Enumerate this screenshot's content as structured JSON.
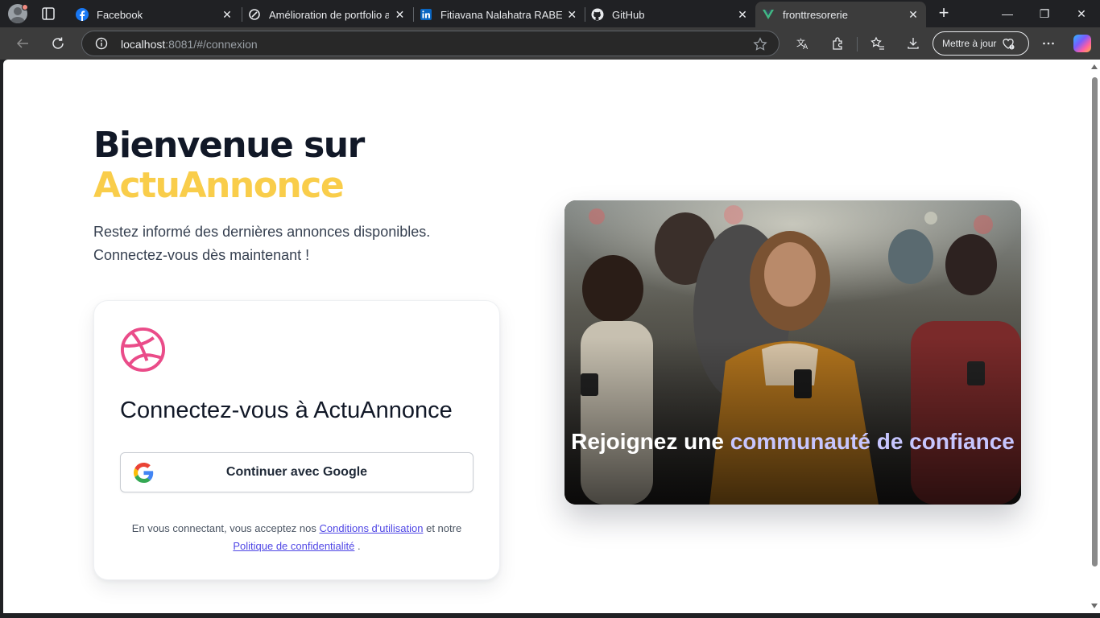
{
  "browser": {
    "tabs": [
      {
        "title": "Facebook",
        "icon": "facebook-icon",
        "active": false
      },
      {
        "title": "Amélioration de portfolio av",
        "icon": "openai-icon",
        "active": false
      },
      {
        "title": "Fitiavana Nalahatra RABEHEV",
        "icon": "linkedin-icon",
        "active": false
      },
      {
        "title": "GitHub",
        "icon": "github-icon",
        "active": false
      },
      {
        "title": "fronttresorerie",
        "icon": "vue-icon",
        "active": true
      }
    ],
    "url_host": "localhost",
    "url_rest": ":8081/#/connexion",
    "update_label": "Mettre à jour"
  },
  "page": {
    "title_line1": "Bienvenue sur",
    "title_brand": "ActuAnnonce",
    "subtitle_line1": "Restez informé des dernières annonces disponibles.",
    "subtitle_line2": "Connectez-vous dès maintenant !",
    "card": {
      "title": "Connectez-vous à ActuAnnonce",
      "google_button": "Continuer avec Google",
      "legal_prefix": "En vous connectant, vous acceptez nos",
      "terms_link": "Conditions d'utilisation",
      "legal_middle": "et notre",
      "privacy_link": "Politique de confidentialité",
      "legal_suffix": "."
    },
    "promo": {
      "text_plain": "Rejoignez une",
      "text_accent": "communauté de confiance"
    }
  },
  "colors": {
    "brand_yellow": "#f9cd4a",
    "link": "#4f46e5",
    "logo_pink": "#ea4c89",
    "promo_accent": "#c7c6ff"
  }
}
